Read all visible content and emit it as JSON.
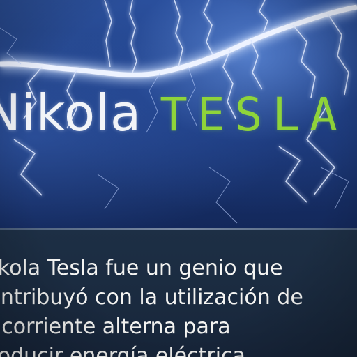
{
  "title": {
    "first": "Nikola",
    "last": "TESLA"
  },
  "body": {
    "text": "Nikola Tesla fue un genio que\ncontribuyó con la utilización de\nla corriente alterna para\nproducir energía eléctrica"
  },
  "colors": {
    "title_first": "#f2f4f8",
    "title_last": "#8fd43a",
    "banner": "#1e3b7a",
    "panel": "#1d2f45",
    "lightning": "#e8f0ff"
  }
}
